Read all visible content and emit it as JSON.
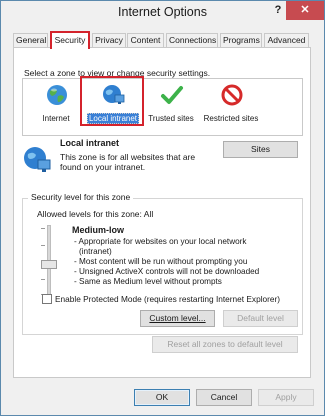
{
  "window": {
    "title": "Internet Options",
    "help_label": "?",
    "close_label": "✕"
  },
  "tabs": [
    {
      "label": "General",
      "active": false
    },
    {
      "label": "Security",
      "active": true
    },
    {
      "label": "Privacy",
      "active": false
    },
    {
      "label": "Content",
      "active": false
    },
    {
      "label": "Connections",
      "active": false
    },
    {
      "label": "Programs",
      "active": false
    },
    {
      "label": "Advanced",
      "active": false
    }
  ],
  "security": {
    "instruction": "Select a zone to view or change security settings.",
    "zones": [
      {
        "label": "Internet",
        "icon": "globe-icon",
        "selected": false
      },
      {
        "label": "Local intranet",
        "icon": "intranet-globe-icon",
        "selected": true
      },
      {
        "label": "Trusted sites",
        "icon": "checkmark-icon",
        "selected": false
      },
      {
        "label": "Restricted sites",
        "icon": "restricted-icon",
        "selected": false
      }
    ],
    "selected_zone": {
      "name": "Local intranet",
      "description": "This zone is for all websites that are found on your intranet.",
      "sites_button": "Sites"
    },
    "level_group": {
      "title": "Security level for this zone",
      "allowed": "Allowed levels for this zone: All",
      "level_name": "Medium-low",
      "level_details": [
        "- Appropriate for websites on your local network",
        "(intranet)",
        "- Most content will be run without prompting you",
        "- Unsigned ActiveX controls will not be downloaded",
        "- Same as Medium level without prompts"
      ],
      "protected_mode_label": "Enable Protected Mode (requires restarting Internet Explorer)",
      "protected_mode_checked": false,
      "custom_level_button": "Custom level...",
      "default_level_button": "Default level"
    },
    "reset_all_button": "Reset all zones to default level"
  },
  "footer": {
    "ok_button": "OK",
    "cancel_button": "Cancel",
    "apply_button": "Apply"
  },
  "colors": {
    "highlight_border": "#d4232c",
    "selection_bg": "#3a80d6",
    "close_button_bg": "#c74b50"
  }
}
